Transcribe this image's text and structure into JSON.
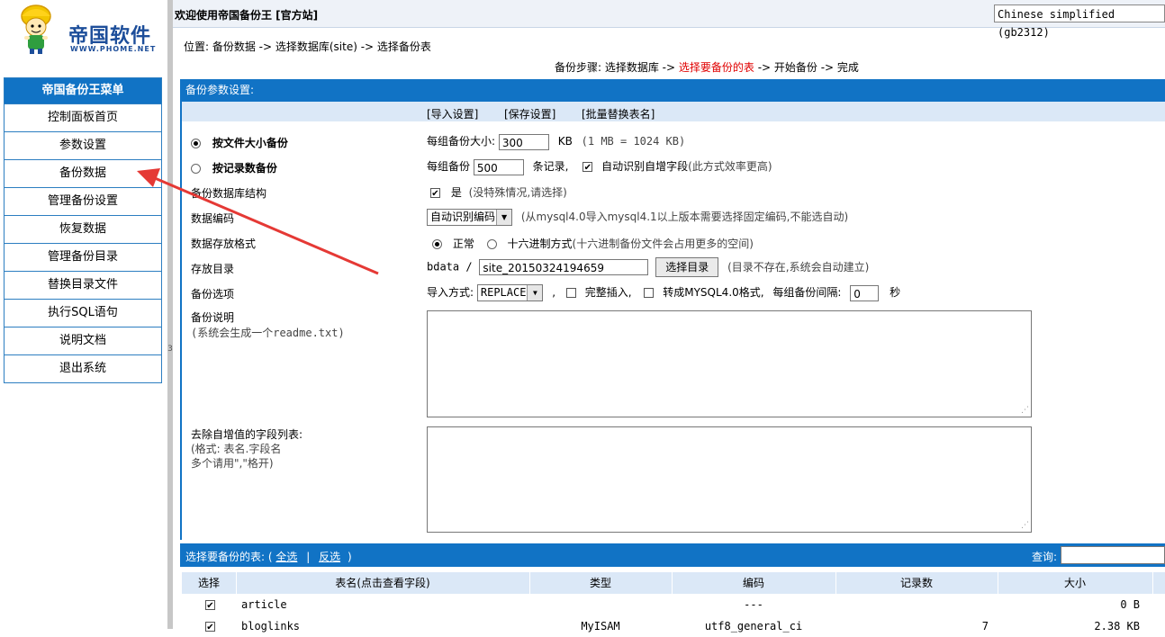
{
  "logo": {
    "name": "帝国软件",
    "sub": "WWW.PHOME.NET"
  },
  "menu": {
    "title": "帝国备份王菜单",
    "items": [
      "控制面板首页",
      "参数设置",
      "备份数据",
      "管理备份设置",
      "恢复数据",
      "管理备份目录",
      "替换目录文件",
      "执行SQL语句",
      "说明文档",
      "退出系统"
    ]
  },
  "splitter": {
    "mark": "3"
  },
  "header": {
    "welcome": "欢迎使用帝国备份王 [官方站]",
    "language": "Chinese simplified (gb2312)"
  },
  "location": "位置: 备份数据 -> 选择数据库(site) -> 选择备份表",
  "steps": {
    "prefix": "备份步骤: 选择数据库 -> ",
    "current": "选择要备份的表",
    "suffix": " -> 开始备份 -> 完成"
  },
  "panel": {
    "title": "备份参数设置:",
    "links": [
      "[导入设置]",
      "[保存设置]",
      "[批量替换表名]"
    ],
    "by_size": {
      "label": "按文件大小备份",
      "prefix": "每组备份大小:",
      "value": "300",
      "unit": "KB",
      "note": "(1 MB = 1024 KB)"
    },
    "by_records": {
      "label": "按记录数备份",
      "prefix": "每组备份",
      "value": "500",
      "unit": "条记录,",
      "auto_label": "自动识别自增字段",
      "auto_note": "(此方式效率更高)"
    },
    "structure": {
      "label": "备份数据库结构",
      "option": "是",
      "note": "(没特殊情况,请选择)"
    },
    "encoding": {
      "label": "数据编码",
      "value": "自动识别编码",
      "note": "(从mysql4.0导入mysql4.1以上版本需要选择固定编码,不能选自动)"
    },
    "format": {
      "label": "数据存放格式",
      "normal": "正常",
      "hex": "十六进制方式",
      "hex_note": "(十六进制备份文件会占用更多的空间)"
    },
    "directory": {
      "label": "存放目录",
      "prefix": "bdata /",
      "value": "site_20150324194659",
      "button": "选择目录",
      "note": "(目录不存在,系统会自动建立)"
    },
    "options": {
      "label": "备份选项",
      "import_label": "导入方式:",
      "import_value": "REPLACE",
      "full_insert": "完整插入,",
      "mysql40": "转成MYSQL4.0格式,",
      "interval_label": "每组备份间隔:",
      "interval_value": "0",
      "interval_unit": "秒"
    },
    "readme": {
      "label": "备份说明",
      "note": "(系统会生成一个readme.txt)"
    },
    "remove": {
      "label": "去除自增值的字段列表:",
      "note1": "(格式: 表名.字段名",
      "note2": "多个请用\",\"格开)"
    }
  },
  "tables": {
    "title": "选择要备份的表: (",
    "select_all": "全选",
    "sep": "|",
    "invert": "反选",
    "close": ")",
    "query_label": "查询:",
    "columns": [
      "选择",
      "表名(点击查看字段)",
      "类型",
      "编码",
      "记录数",
      "大小"
    ],
    "rows": [
      {
        "name": "article",
        "type": "",
        "encoding": "---",
        "records": "",
        "size": "0 B"
      },
      {
        "name": "bloglinks",
        "type": "MyISAM",
        "encoding": "utf8_general_ci",
        "records": "7",
        "size": "2.38 KB"
      }
    ]
  },
  "colors": {
    "accent": "#1173c5",
    "highlight": "#e00000",
    "arrow": "#e53935"
  }
}
